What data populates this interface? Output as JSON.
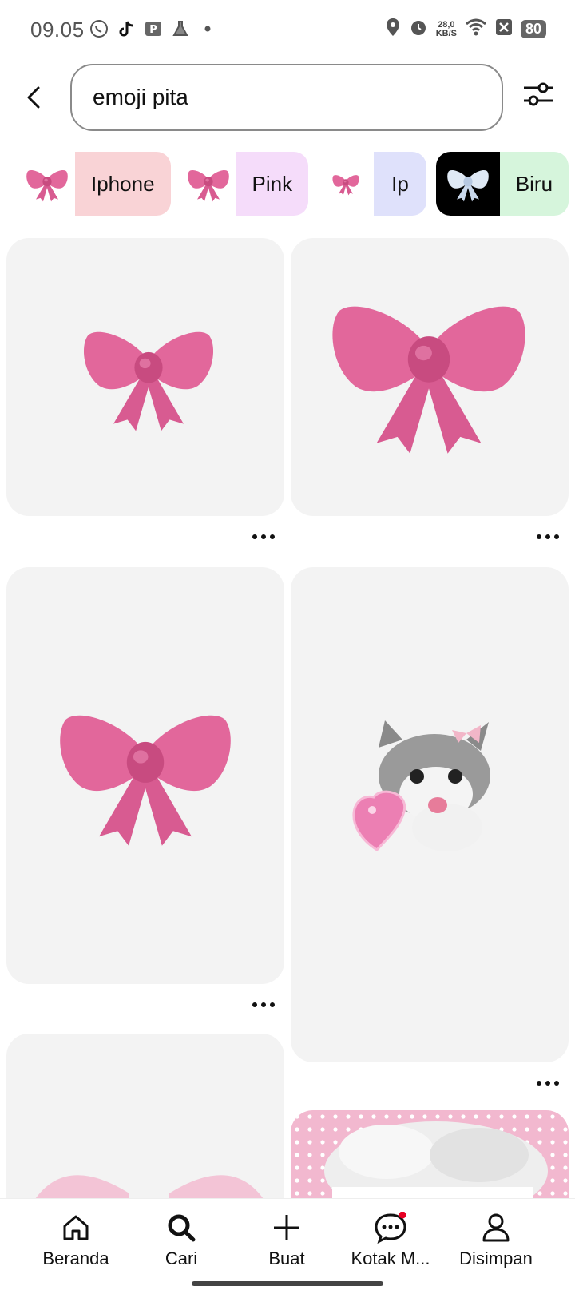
{
  "status": {
    "time": "09.05",
    "net_speed_value": "28,0",
    "net_speed_unit": "KB/S",
    "battery": "80"
  },
  "search": {
    "query": "emoji pita"
  },
  "chips": [
    {
      "label": "Iphone"
    },
    {
      "label": "Pink"
    },
    {
      "label": "Ip"
    },
    {
      "label": "Biru"
    }
  ],
  "nav": {
    "home": "Beranda",
    "search": "Cari",
    "create": "Buat",
    "inbox": "Kotak M...",
    "saved": "Disimpan"
  },
  "colors": {
    "bow_pink": "#e2679b",
    "bow_dark": "#c84b80",
    "chip_iphone": "#f9d3d6",
    "chip_pink": "#f5dcfa",
    "chip_ip": "#dfe1fb",
    "chip_biru": "#d6f5dc",
    "notification_dot": "#e60023"
  }
}
